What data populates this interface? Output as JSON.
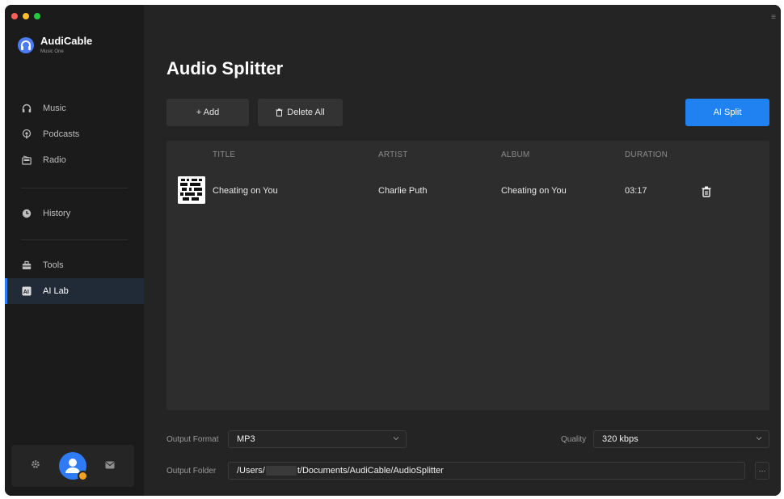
{
  "app": {
    "name": "AudiCable",
    "subtitle": "Music One"
  },
  "sidebar": {
    "items": [
      {
        "label": "Music",
        "icon": "headphones-icon"
      },
      {
        "label": "Podcasts",
        "icon": "podcast-icon"
      },
      {
        "label": "Radio",
        "icon": "radio-icon"
      },
      {
        "label": "History",
        "icon": "clock-icon"
      },
      {
        "label": "Tools",
        "icon": "toolbox-icon"
      },
      {
        "label": "AI Lab",
        "icon": "ai-icon",
        "active": true
      }
    ]
  },
  "main": {
    "title": "Audio Splitter",
    "toolbar": {
      "add_label": "+ Add",
      "delete_all_label": "Delete All",
      "ai_split_label": "AI Split"
    },
    "table": {
      "headers": [
        "TITLE",
        "ARTIST",
        "ALBUM",
        "DURATION"
      ],
      "rows": [
        {
          "title": "Cheating on You",
          "artist": "Charlie Puth",
          "album": "Cheating on You",
          "duration": "03:17"
        }
      ]
    },
    "output": {
      "format_label": "Output Format",
      "format_value": "MP3",
      "quality_label": "Quality",
      "quality_value": "320 kbps",
      "folder_label": "Output Folder",
      "folder_prefix": "/Users/",
      "folder_suffix": "t/Documents/AudiCable/AudioSplitter",
      "browse_label": "···"
    }
  },
  "colors": {
    "accent": "#1f82f0",
    "sidebar_bg": "#1b1b1b",
    "main_bg": "#242424",
    "table_bg": "#2d2d2d"
  }
}
